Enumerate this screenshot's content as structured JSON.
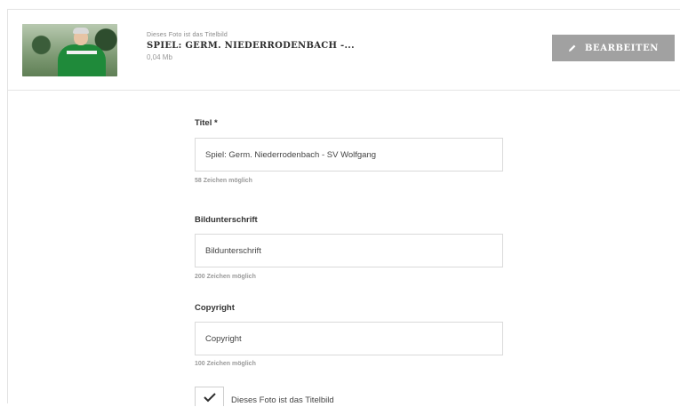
{
  "header": {
    "cover_note": "Dieses Foto ist das Titelbild",
    "photo_title": "SPIEL: GERM. NIEDERRODENBACH -...",
    "file_size": "0,04 Mb",
    "thumbnail_icon": "photo-thumbnail",
    "edit_button": {
      "label": "BEARBEITEN",
      "icon": "pencil-icon",
      "color": "#a1a1a1"
    }
  },
  "form": {
    "title_field": {
      "label": "Titel *",
      "value": "Spiel: Germ. Niederrodenbach - SV Wolfgang",
      "hint": "58 Zeichen möglich"
    },
    "caption_field": {
      "label": "Bildunterschrift",
      "placeholder": "Bildunterschrift",
      "hint": "200 Zeichen möglich"
    },
    "copyright_field": {
      "label": "Copyright",
      "placeholder": "Copyright",
      "hint": "100 Zeichen möglich"
    },
    "cover_checkbox": {
      "label": "Dieses Foto ist das Titelbild",
      "checked": true,
      "icon": "checkmark-icon"
    }
  }
}
